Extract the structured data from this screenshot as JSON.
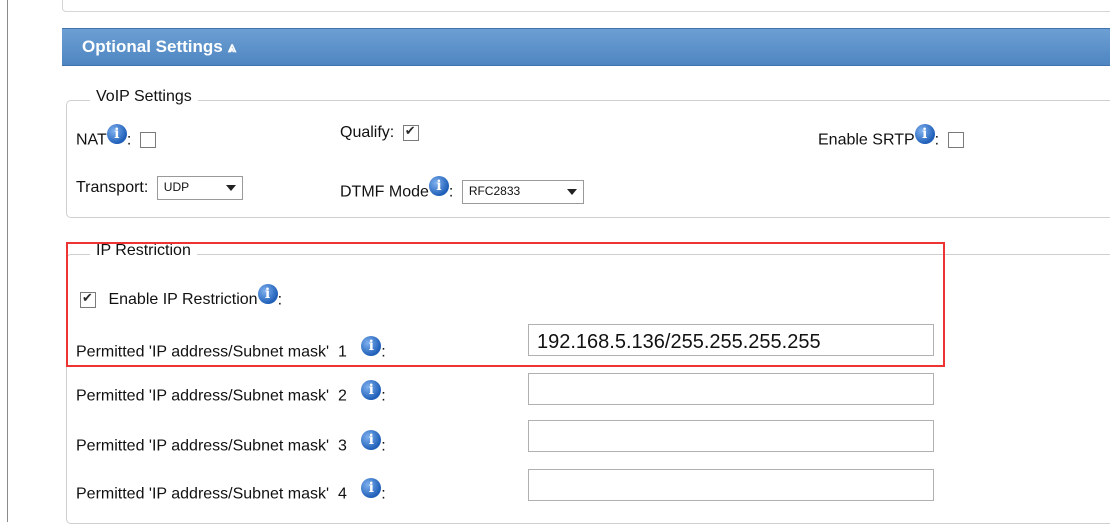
{
  "header": {
    "title": "Optional Settings",
    "chevron": "⩓"
  },
  "voip": {
    "legend": "VoIP Settings",
    "nat_label": "NAT",
    "qualify_label": "Qualify:",
    "srtp_label": "Enable SRTP",
    "transport_label": "Transport:",
    "transport_value": "UDP",
    "dtmf_label": "DTMF Mode",
    "dtmf_value": "RFC2833",
    "colon": ":"
  },
  "ip": {
    "legend": "IP Restriction",
    "enable_label": "Enable IP Restriction",
    "rows": [
      {
        "label": "Permitted 'IP address/Subnet mask'  1",
        "value": "192.168.5.136/255.255.255.255"
      },
      {
        "label": "Permitted 'IP address/Subnet mask'  2",
        "value": ""
      },
      {
        "label": "Permitted 'IP address/Subnet mask'  3",
        "value": ""
      },
      {
        "label": "Permitted 'IP address/Subnet mask'  4",
        "value": ""
      }
    ]
  },
  "icons": {
    "info": "i"
  },
  "colors": {
    "header": "#5a8fcb",
    "highlight": "#e33333"
  }
}
